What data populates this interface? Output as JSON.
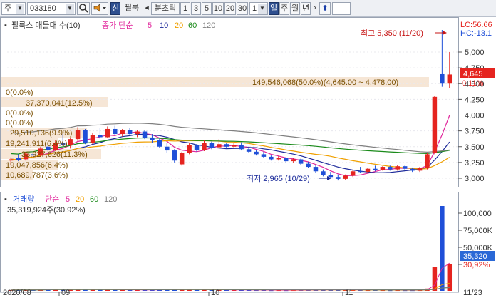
{
  "toolbar": {
    "market_code": "주",
    "stock_code": "033180",
    "tool_badge": "신",
    "stock_name": "필룩",
    "chart_unit_label": "분초틱",
    "periods": [
      "1",
      "3",
      "5",
      "10",
      "20",
      "30"
    ],
    "count_value": "1",
    "timeframes": [
      "일",
      "주",
      "월",
      "년"
    ],
    "next_arrow": "›",
    "updown_icon": "⬍"
  },
  "price_panel": {
    "legend_name": "필룩스 매물대 수(10)",
    "legend_ma_prefix": "종가 단순",
    "ma_periods": [
      "5",
      "10",
      "20",
      "60",
      "120"
    ],
    "ma_colors": [
      "#e0269b",
      "#1d2a9a",
      "#f0a000",
      "#1a8a1a",
      "#7f7f7f"
    ],
    "high_annotation": "최고 5,350 (11/20)",
    "low_annotation": "최저 2,965 (10/29)",
    "volume_profile_main": "149,546,068(50.0%)(4,645.00 ~ 4,478.00)",
    "volume_profile_labels": [
      "0(0.0%)",
      "37,370,041(12.5%)",
      "0(0.0%)",
      "0(0.0%)",
      "29,510,136(9.9%)",
      "19,241,911(6.4%)",
      "33,927,626(11.3%)",
      "19,047,856(6.4%)",
      "10,689,787(3.6%)"
    ],
    "axis_labels": [
      "5,000",
      "4,750",
      "4,500",
      "4,250",
      "4,000",
      "3,750",
      "3,500",
      "3,250",
      "3,000"
    ],
    "lc_label": "LC:56.66",
    "hc_label": "HC:-13.1",
    "last_price_tag": "4,645",
    "pct_label": "0.11%"
  },
  "volume_panel": {
    "legend_name": "거래량",
    "legend_ma_prefix": "단순",
    "ma_periods": [
      "5",
      "20",
      "60",
      "120"
    ],
    "ma_colors": [
      "#e0269b",
      "#f0a000",
      "#1a8a1a",
      "#7f7f7f"
    ],
    "current_volume": "35,319,924주(30.92%)",
    "axis_labels": [
      "100,000",
      "75,000K",
      "50,000K",
      "30,92%"
    ],
    "last_volume_tag": "35,320"
  },
  "x_axis": {
    "labels": [
      "2020/08",
      "09",
      "10",
      "11",
      "11/23"
    ]
  },
  "colors": {
    "up": "#e5241f",
    "down": "#1f4fd8",
    "accent_toolbar": "#2e4f8f",
    "vp_band": "#f5e2cf",
    "price_tag_bg": "#e5241f",
    "vol_tag_bg": "#2a68d6"
  },
  "chart_data": {
    "type": "candlestick",
    "x_axis_labels": [
      "2020/08",
      "09",
      "10",
      "11",
      "11/23"
    ],
    "price_axis": [
      "5,000",
      "4,750",
      "4,500",
      "4,250",
      "4,000",
      "3,750",
      "3,500",
      "3,250",
      "3,000"
    ],
    "candles": [
      {
        "o": 3280,
        "h": 3330,
        "l": 3200,
        "c": 3300
      },
      {
        "o": 3320,
        "h": 3380,
        "l": 3270,
        "c": 3290
      },
      {
        "o": 3300,
        "h": 3420,
        "l": 3280,
        "c": 3390
      },
      {
        "o": 3380,
        "h": 3440,
        "l": 3330,
        "c": 3360
      },
      {
        "o": 3360,
        "h": 3500,
        "l": 3340,
        "c": 3470
      },
      {
        "o": 3500,
        "h": 3560,
        "l": 3420,
        "c": 3450
      },
      {
        "o": 3450,
        "h": 3600,
        "l": 3430,
        "c": 3560
      },
      {
        "o": 3560,
        "h": 3700,
        "l": 3500,
        "c": 3520
      },
      {
        "o": 3520,
        "h": 3640,
        "l": 3470,
        "c": 3620
      },
      {
        "o": 3620,
        "h": 3810,
        "l": 3590,
        "c": 3760
      },
      {
        "o": 3760,
        "h": 3780,
        "l": 3540,
        "c": 3560
      },
      {
        "o": 3560,
        "h": 3720,
        "l": 3540,
        "c": 3680
      },
      {
        "o": 3680,
        "h": 3800,
        "l": 3620,
        "c": 3650
      },
      {
        "o": 3650,
        "h": 3820,
        "l": 3640,
        "c": 3780
      },
      {
        "o": 3780,
        "h": 3830,
        "l": 3690,
        "c": 3700
      },
      {
        "o": 3700,
        "h": 3780,
        "l": 3660,
        "c": 3760
      },
      {
        "o": 3760,
        "h": 3800,
        "l": 3680,
        "c": 3700
      },
      {
        "o": 3700,
        "h": 3760,
        "l": 3650,
        "c": 3740
      },
      {
        "o": 3740,
        "h": 3760,
        "l": 3620,
        "c": 3640
      },
      {
        "o": 3640,
        "h": 3700,
        "l": 3560,
        "c": 3600
      },
      {
        "o": 3600,
        "h": 3640,
        "l": 3480,
        "c": 3500
      },
      {
        "o": 3500,
        "h": 3560,
        "l": 3400,
        "c": 3440
      },
      {
        "o": 3440,
        "h": 3460,
        "l": 3250,
        "c": 3280
      },
      {
        "o": 3220,
        "h": 3420,
        "l": 3200,
        "c": 3400
      },
      {
        "o": 3400,
        "h": 3560,
        "l": 3380,
        "c": 3530
      },
      {
        "o": 3520,
        "h": 3540,
        "l": 3420,
        "c": 3450
      },
      {
        "o": 3450,
        "h": 3600,
        "l": 3430,
        "c": 3560
      },
      {
        "o": 3560,
        "h": 3580,
        "l": 3460,
        "c": 3480
      },
      {
        "o": 3490,
        "h": 3620,
        "l": 3480,
        "c": 3540
      },
      {
        "o": 3540,
        "h": 3560,
        "l": 3470,
        "c": 3500
      },
      {
        "o": 3500,
        "h": 3560,
        "l": 3480,
        "c": 3530
      },
      {
        "o": 3530,
        "h": 3570,
        "l": 3440,
        "c": 3460
      },
      {
        "o": 3460,
        "h": 3500,
        "l": 3400,
        "c": 3420
      },
      {
        "o": 3420,
        "h": 3440,
        "l": 3360,
        "c": 3380
      },
      {
        "o": 3380,
        "h": 3420,
        "l": 3320,
        "c": 3340
      },
      {
        "o": 3340,
        "h": 3360,
        "l": 3280,
        "c": 3300
      },
      {
        "o": 3300,
        "h": 3350,
        "l": 3280,
        "c": 3320
      },
      {
        "o": 3320,
        "h": 3330,
        "l": 3250,
        "c": 3270
      },
      {
        "o": 3270,
        "h": 3320,
        "l": 3240,
        "c": 3300
      },
      {
        "o": 3300,
        "h": 3310,
        "l": 3210,
        "c": 3230
      },
      {
        "o": 3230,
        "h": 3260,
        "l": 3160,
        "c": 3180
      },
      {
        "o": 3180,
        "h": 3210,
        "l": 3090,
        "c": 3110
      },
      {
        "o": 3110,
        "h": 3140,
        "l": 3030,
        "c": 3050
      },
      {
        "o": 3050,
        "h": 3100,
        "l": 3000,
        "c": 3020
      },
      {
        "o": 3020,
        "h": 3060,
        "l": 2965,
        "c": 2990
      },
      {
        "o": 2990,
        "h": 3060,
        "l": 2970,
        "c": 3040
      },
      {
        "o": 3040,
        "h": 3130,
        "l": 3020,
        "c": 3110
      },
      {
        "o": 3110,
        "h": 3180,
        "l": 3080,
        "c": 3100
      },
      {
        "o": 3100,
        "h": 3160,
        "l": 3080,
        "c": 3150
      },
      {
        "o": 3150,
        "h": 3200,
        "l": 3110,
        "c": 3130
      },
      {
        "o": 3130,
        "h": 3190,
        "l": 3120,
        "c": 3180
      },
      {
        "o": 3180,
        "h": 3200,
        "l": 3120,
        "c": 3140
      },
      {
        "o": 3140,
        "h": 3210,
        "l": 3120,
        "c": 3190
      },
      {
        "o": 3190,
        "h": 3200,
        "l": 3130,
        "c": 3150
      },
      {
        "o": 3150,
        "h": 3170,
        "l": 3100,
        "c": 3120
      },
      {
        "o": 3120,
        "h": 3180,
        "l": 3100,
        "c": 3160
      },
      {
        "o": 3160,
        "h": 3400,
        "l": 3140,
        "c": 3380
      },
      {
        "o": 3400,
        "h": 4300,
        "l": 3380,
        "c": 4290
      },
      {
        "o": 4650,
        "h": 5350,
        "l": 4450,
        "c": 4500
      },
      {
        "o": 4500,
        "h": 5000,
        "l": 4430,
        "c": 4645
      }
    ],
    "volumes": [
      1.0,
      1.2,
      1.4,
      1.1,
      1.6,
      2.4,
      2.6,
      1.5,
      1.8,
      2.2,
      1.9,
      1.6,
      1.4,
      1.7,
      1.2,
      1.3,
      1.2,
      1.1,
      1.4,
      1.3,
      1.5,
      1.7,
      2.1,
      1.8,
      2.0,
      1.2,
      1.4,
      1.2,
      1.6,
      1.1,
      1.0,
      1.2,
      1.0,
      0.9,
      1.0,
      0.8,
      0.9,
      0.8,
      0.9,
      1.0,
      1.1,
      1.2,
      1.3,
      1.3,
      1.5,
      1.1,
      1.2,
      1.0,
      0.9,
      1.0,
      0.9,
      0.8,
      0.9,
      0.8,
      0.8,
      0.9,
      3.0,
      32.0,
      112.0,
      35.3
    ]
  }
}
